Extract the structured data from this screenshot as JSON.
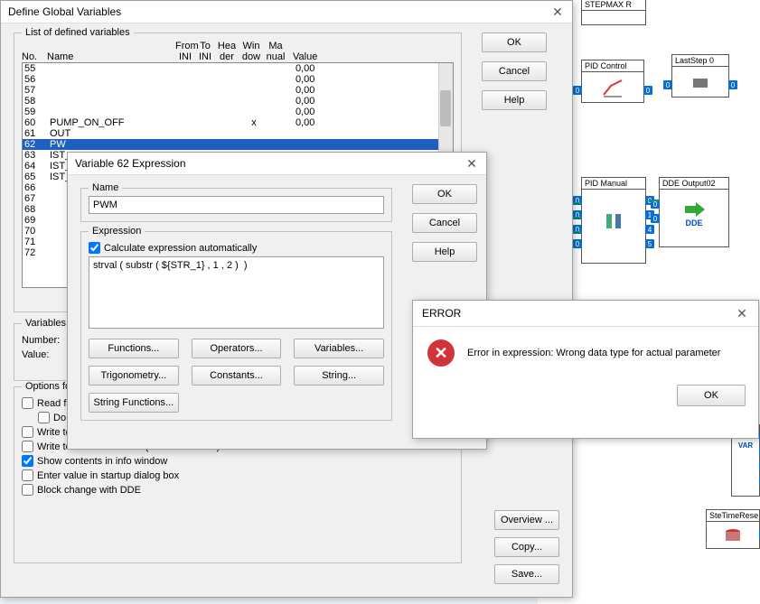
{
  "dgv": {
    "title": "Define Global Variables",
    "list_legend": "List of defined variables",
    "cols": {
      "no": "No.",
      "name": "Name",
      "fini": "From INI",
      "tini": "To INI",
      "hea": "Hea der",
      "win": "Win dow",
      "ma": "Ma nual",
      "value": "Value"
    },
    "rows": [
      {
        "no": "55",
        "name": "",
        "x": "",
        "value": "0,00"
      },
      {
        "no": "56",
        "name": "",
        "x": "",
        "value": "0,00"
      },
      {
        "no": "57",
        "name": "",
        "x": "",
        "value": "0,00"
      },
      {
        "no": "58",
        "name": "",
        "x": "",
        "value": "0,00"
      },
      {
        "no": "59",
        "name": "",
        "x": "",
        "value": "0,00"
      },
      {
        "no": "60",
        "name": "PUMP_ON_OFF",
        "x": "x",
        "value": "0,00"
      },
      {
        "no": "61",
        "name": "OUT",
        "x": "",
        "value": ""
      },
      {
        "no": "62",
        "name": "PW",
        "x": "",
        "value": "",
        "sel": true
      },
      {
        "no": "63",
        "name": "IST_",
        "x": "",
        "value": ""
      },
      {
        "no": "64",
        "name": "IST_",
        "x": "",
        "value": ""
      },
      {
        "no": "65",
        "name": "IST_",
        "x": "",
        "value": ""
      },
      {
        "no": "66",
        "name": "",
        "x": "",
        "value": ""
      },
      {
        "no": "67",
        "name": "",
        "x": "",
        "value": ""
      },
      {
        "no": "68",
        "name": "",
        "x": "",
        "value": ""
      },
      {
        "no": "69",
        "name": "",
        "x": "",
        "value": ""
      },
      {
        "no": "70",
        "name": "",
        "x": "",
        "value": ""
      },
      {
        "no": "71",
        "name": "",
        "x": "",
        "value": ""
      },
      {
        "no": "72",
        "name": "",
        "x": "",
        "value": ""
      }
    ],
    "btn_ok": "OK",
    "btn_cancel": "Cancel",
    "btn_help": "Help",
    "varctx": {
      "legend": "Variables",
      "number_label": "Number:",
      "value_label": "Value:"
    },
    "opts": {
      "legend": "Options fo",
      "read_fr": "Read fr",
      "no_overwrite": "Do not overwrite description",
      "write_ini": "Write to INI file when measurement stops",
      "write_ddf": "Write to data file header (DDF and ASCII)",
      "show_info": "Show contents in info window",
      "enter_startup": "Enter value in startup dialog box",
      "block_dde": "Block change with DDE"
    },
    "btn_overview": "Overview ...",
    "btn_copy": "Copy...",
    "btn_save": "Save..."
  },
  "vex": {
    "title": "Variable 62 Expression",
    "name_legend": "Name",
    "name_value": "PWM",
    "expr_legend": "Expression",
    "calc_auto": "Calculate expression automatically",
    "expr_value": "strval ( substr ( ${STR_1} , 1 , 2 )  )",
    "btn_ok": "OK",
    "btn_cancel": "Cancel",
    "btn_help": "Help",
    "fn": {
      "functions": "Functions...",
      "operators": "Operators...",
      "variables": "Variables...",
      "trig": "Trigonometry...",
      "constants": "Constants...",
      "string": "String...",
      "strfn": "String Functions..."
    }
  },
  "err": {
    "title": "ERROR",
    "message": "Error in expression: Wrong data type for actual parameter",
    "btn_ok": "OK"
  },
  "bg": {
    "stepmax": "STEPMAX R",
    "pid_control": "PID Control",
    "laststep": "LastStep 0",
    "pid_manual": "PID Manual",
    "dde_output": "DDE Output02",
    "var": "VAR",
    "dde": "DDE",
    "ste": "SteTimeRese"
  }
}
